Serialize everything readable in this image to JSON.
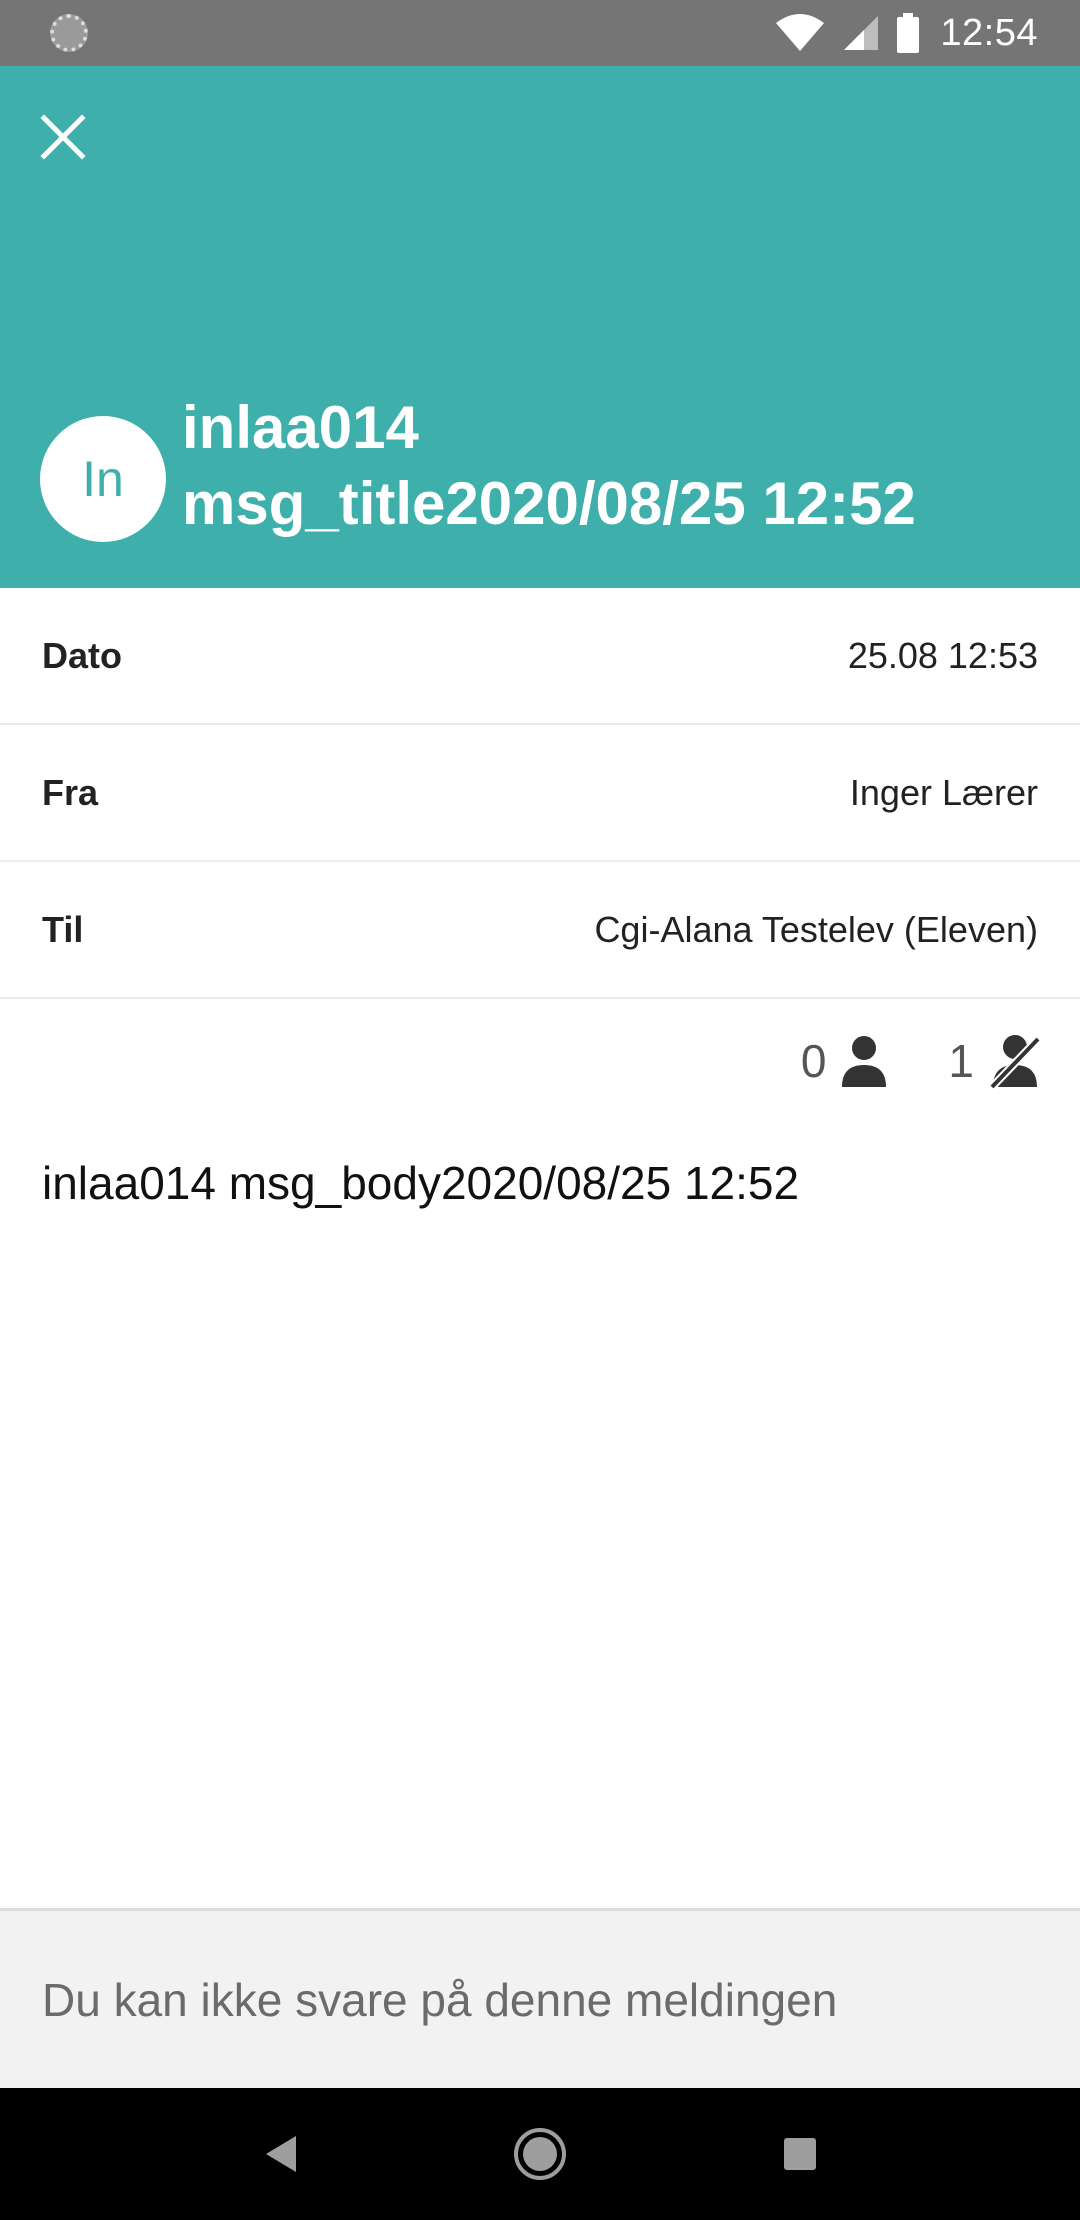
{
  "status_bar": {
    "time": "12:54",
    "icons": [
      "sync-icon",
      "wifi-icon",
      "signal-icon",
      "battery-icon"
    ]
  },
  "header": {
    "background_color": "#3fafab",
    "close_icon": "close-icon",
    "avatar_initials": "In",
    "title_line1": "inlaa014",
    "title_line2": "msg_title2020/08/25 12:52"
  },
  "details": {
    "date": {
      "label": "Dato",
      "value": "25.08 12:53"
    },
    "from": {
      "label": "Fra",
      "value": "Inger Lærer"
    },
    "to": {
      "label": "Til",
      "value": "Cgi-Alana Testelev (Eleven)"
    }
  },
  "read_status": {
    "read_count": "0",
    "read_icon": "person-icon",
    "unread_count": "1",
    "unread_icon": "person-off-icon"
  },
  "message": {
    "body": "inlaa014 msg_body2020/08/25 12:52"
  },
  "footer": {
    "reply_notice": "Du kan ikke svare på denne meldingen"
  },
  "nav_bar": {
    "buttons": [
      "back-icon",
      "home-icon",
      "recents-icon"
    ]
  }
}
